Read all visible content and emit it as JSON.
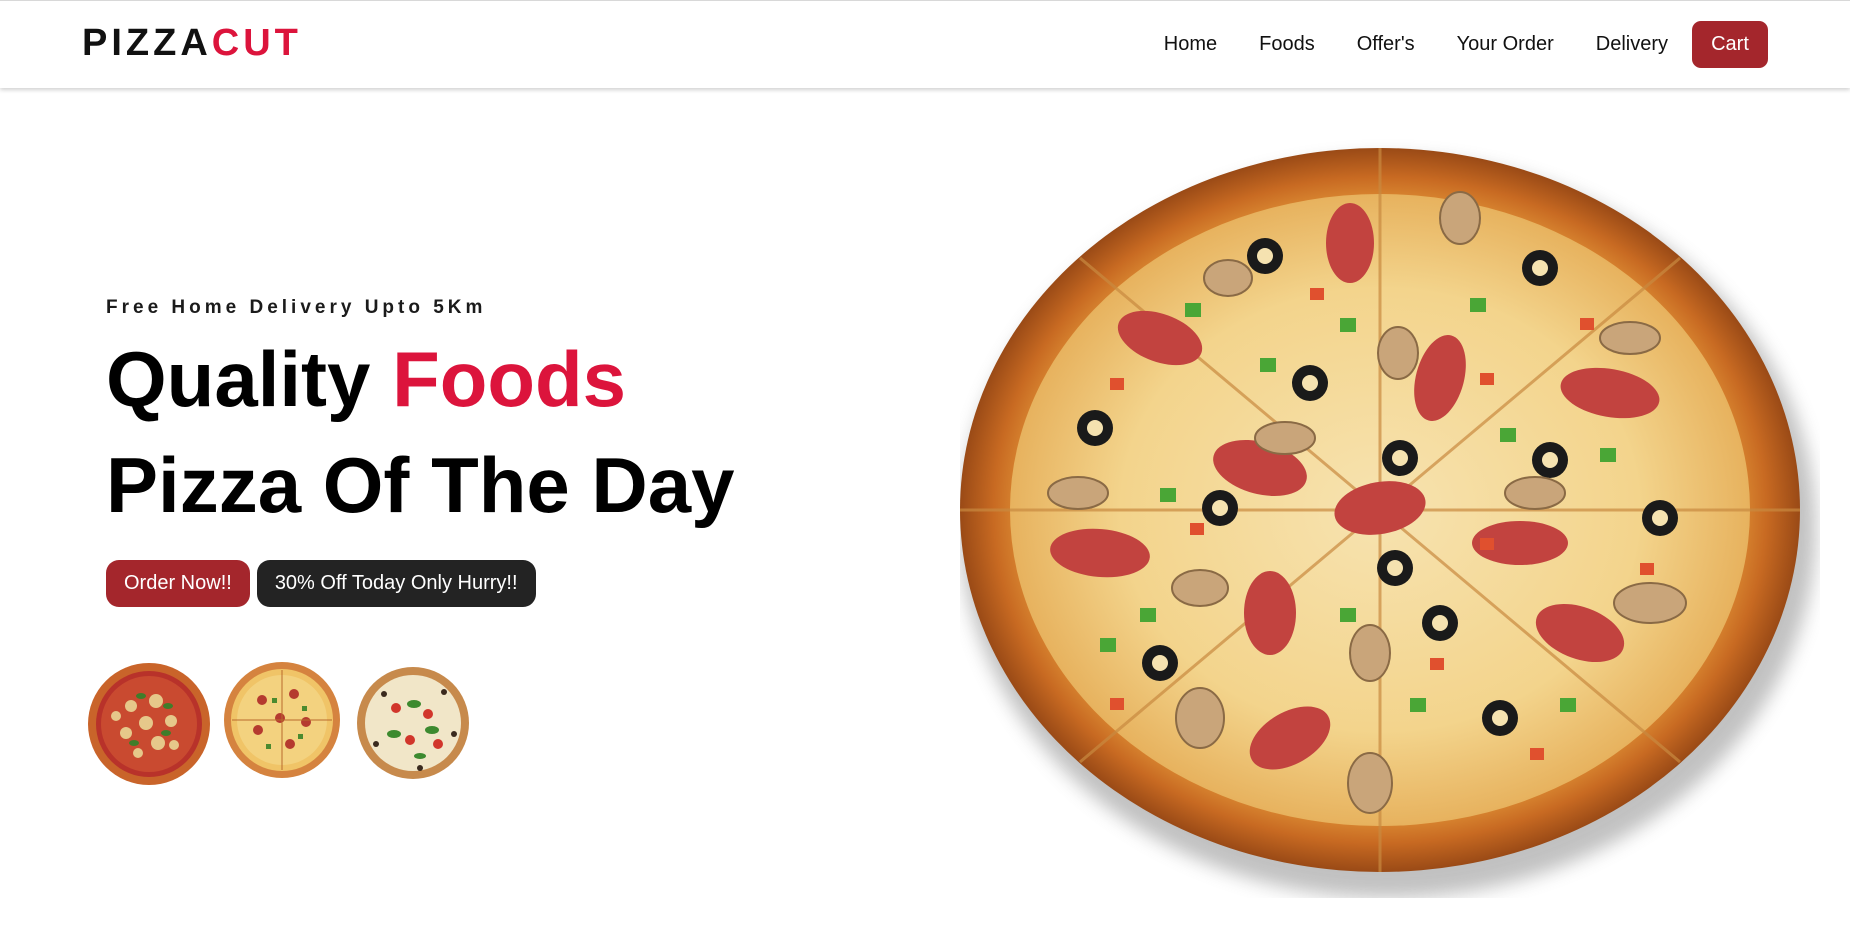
{
  "brand": {
    "name_part1": "PIZZA",
    "name_part2": "CUT",
    "accent_color": "#dc143c"
  },
  "nav": {
    "links": [
      "Home",
      "Foods",
      "Offer's",
      "Your Order",
      "Delivery"
    ],
    "cart_label": "Cart",
    "cart_color": "#a4262c"
  },
  "hero": {
    "tagline": "Free Home Delivery Upto 5Km",
    "headline_word1": "Quality",
    "headline_accent": "Foods",
    "headline_line2": "Pizza Of The Day",
    "order_button": "Order Now!!",
    "offer_button": "30% Off Today Only Hurry!!",
    "order_button_color": "#a4262c",
    "offer_button_color": "#232323"
  },
  "thumbnails": [
    {
      "icon": "pizza-thumbnail-icon"
    },
    {
      "icon": "pizza-thumbnail-icon"
    },
    {
      "icon": "pizza-thumbnail-icon"
    }
  ],
  "hero_image": {
    "icon": "pizza-hero-image"
  }
}
